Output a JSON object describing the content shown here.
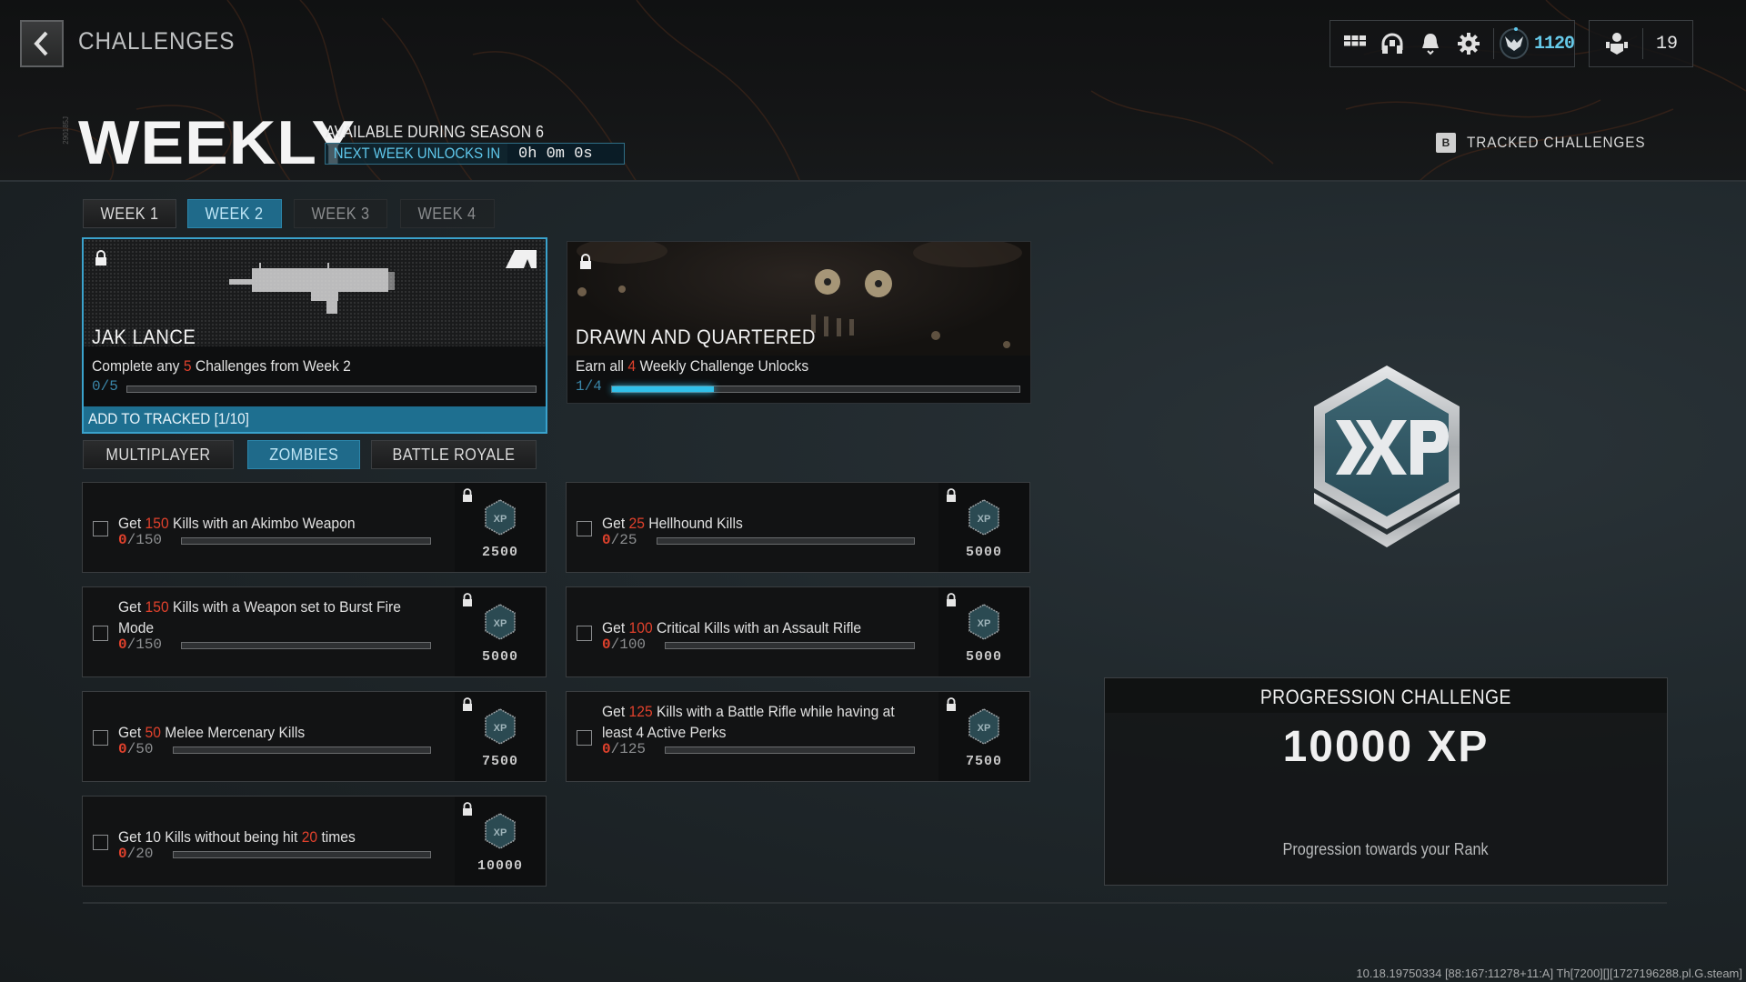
{
  "header": {
    "breadcrumb": "CHALLENGES",
    "title": "WEEKLY",
    "vertical_tag": "290185J",
    "availability": "AVAILABLE DURING SEASON 6",
    "next_unlock_label": "NEXT WEEK UNLOCKS IN",
    "next_unlock_time": "0h 0m 0s",
    "tracked_key": "B",
    "tracked_label": "TRACKED CHALLENGES"
  },
  "topbar": {
    "icons": [
      "grid-menu-icon",
      "headset-icon",
      "bell-icon",
      "gear-icon",
      "rank-emblem-icon",
      "party-icon"
    ],
    "currency": "1120",
    "party_count": "19"
  },
  "week_tabs": [
    {
      "label": "WEEK 1",
      "state": "normal"
    },
    {
      "label": "WEEK 2",
      "state": "active"
    },
    {
      "label": "WEEK 3",
      "state": "dim"
    },
    {
      "label": "WEEK 4",
      "state": "dim"
    }
  ],
  "reward_cards": [
    {
      "title": "JAK LANCE",
      "desc_pre": "Complete any ",
      "desc_num": "5",
      "desc_post": " Challenges from Week 2",
      "progress_text": "0/5",
      "progress": 0,
      "selected": true,
      "track_label": "ADD TO TRACKED [1/10]",
      "brand_logo": "JAK"
    },
    {
      "title": "DRAWN AND QUARTERED",
      "desc_pre": "Earn all ",
      "desc_num": "4",
      "desc_post": " Weekly Challenge Unlocks",
      "progress_text": "1/4",
      "progress": 0.25,
      "selected": false
    }
  ],
  "mode_tabs": [
    {
      "label": "MULTIPLAYER",
      "state": "normal"
    },
    {
      "label": "ZOMBIES",
      "state": "active"
    },
    {
      "label": "BATTLE ROYALE",
      "state": "normal"
    }
  ],
  "challenges": [
    {
      "pre": "Get ",
      "num": "150",
      "post": " Kills with an Akimbo Weapon",
      "current": "0",
      "total": "/150",
      "reward": "2500",
      "lines": 1
    },
    {
      "pre": "Get ",
      "num": "25",
      "post": " Hellhound Kills",
      "current": "0",
      "total": "/25",
      "reward": "5000",
      "lines": 1
    },
    {
      "pre": "Get ",
      "num": "150",
      "post": " Kills with a Weapon set to Burst Fire Mode",
      "current": "0",
      "total": "/150",
      "reward": "5000",
      "lines": 2
    },
    {
      "pre": "Get ",
      "num": "100",
      "post": " Critical Kills with an Assault Rifle",
      "current": "0",
      "total": "/100",
      "reward": "5000",
      "lines": 1
    },
    {
      "pre": "Get ",
      "num": "50",
      "post": " Melee Mercenary Kills",
      "current": "0",
      "total": "/50",
      "reward": "7500",
      "lines": 1
    },
    {
      "pre": "Get ",
      "num": "125",
      "post": " Kills with a Battle Rifle while having at least 4 Active Perks",
      "current": "0",
      "total": "/125",
      "reward": "7500",
      "lines": 2
    },
    {
      "pre": "Get 10 Kills without being hit ",
      "num": "20",
      "post": " times",
      "current": "0",
      "total": "/20",
      "reward": "10000",
      "lines": 1
    }
  ],
  "progression": {
    "heading": "PROGRESSION CHALLENGE",
    "xp": "10000 XP",
    "subtitle": "Progression towards your Rank",
    "badge_label": "XP"
  },
  "footer": "10.18.19750334 [88:167:11278+11:A] Th[7200][][1727196288.pl.G.steam]",
  "colors": {
    "accent": "#1f6a8a",
    "accent_bright": "#31c1ea",
    "highlight_red": "#e0412c"
  }
}
